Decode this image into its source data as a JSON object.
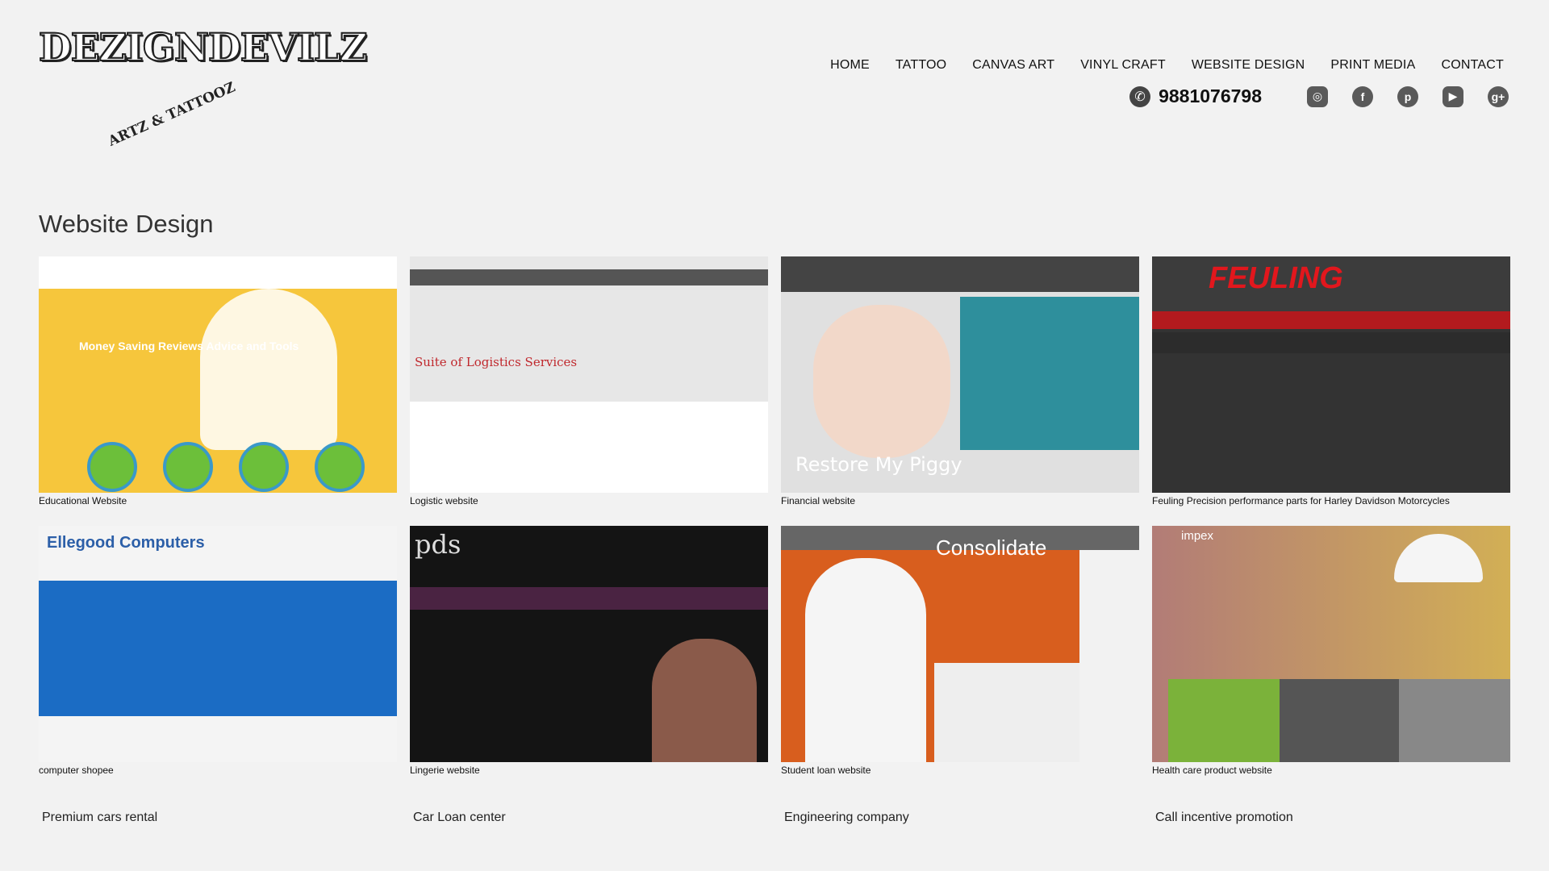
{
  "brand": {
    "logo_text": "DEZIGNDEVILZ",
    "logo_sub": "ARTZ & TATTOOZ"
  },
  "nav": [
    "HOME",
    "TATTOO",
    "CANVAS ART",
    "VINYL CRAFT",
    "WEBSITE DESIGN",
    "PRINT MEDIA",
    "CONTACT"
  ],
  "contact": {
    "phone": "9881076798",
    "social": [
      "instagram-icon",
      "facebook-icon",
      "pinterest-icon",
      "youtube-icon",
      "google-plus-icon"
    ]
  },
  "page_title": "Website Design",
  "portfolio": [
    {
      "caption": "Educational Website",
      "thumb_text": "Money Saving Reviews Advice and Tools"
    },
    {
      "caption": "Logistic website",
      "thumb_text": "Suite of Logistics Services"
    },
    {
      "caption": "Financial website",
      "thumb_text": "Restore My Piggy"
    },
    {
      "caption": "Feuling Precision performance parts for Harley Davidson Motorcycles",
      "thumb_text": "FEULING"
    },
    {
      "caption": "computer shopee",
      "thumb_text": "Ellegood Computers"
    },
    {
      "caption": "Lingerie website",
      "thumb_text": "pds"
    },
    {
      "caption": "Student loan website",
      "thumb_text": "Consolidate"
    },
    {
      "caption": "Health care product website",
      "thumb_text": "impex"
    }
  ],
  "more_titles": [
    "Premium cars rental",
    "Car Loan center",
    "Engineering company",
    "Call incentive promotion"
  ],
  "colors": {
    "background": "#f2f2f2",
    "text": "#222222",
    "icon": "#5a5a5a"
  }
}
